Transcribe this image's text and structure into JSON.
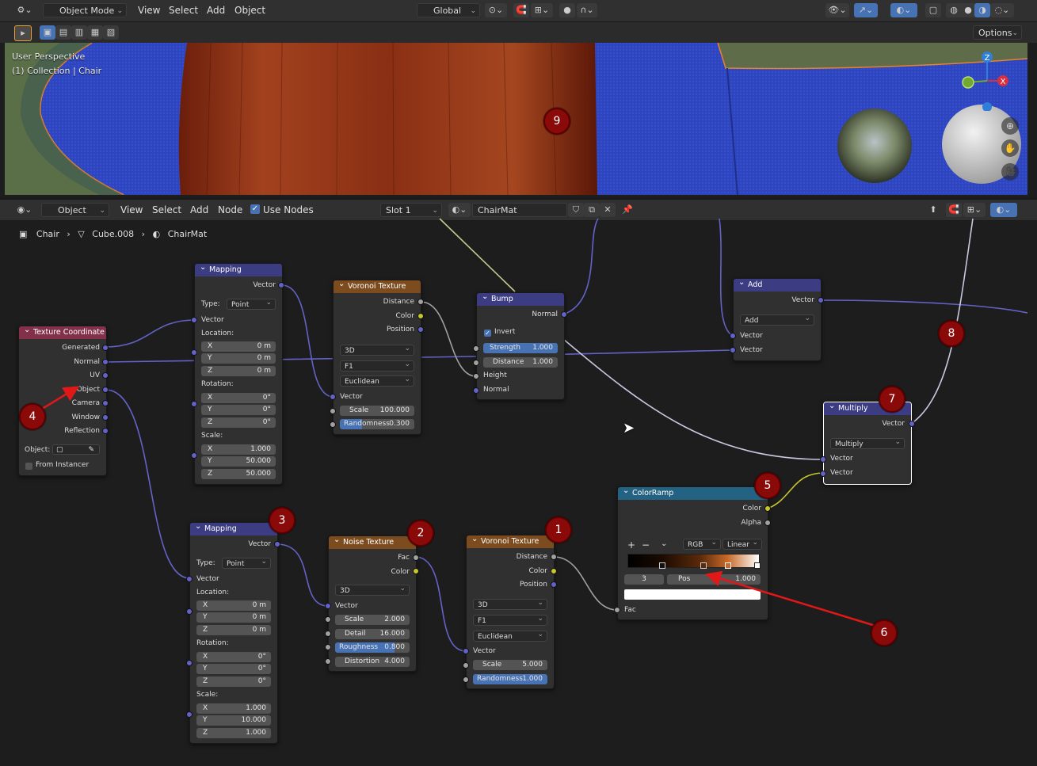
{
  "viewport_header": {
    "mode": "Object Mode",
    "menu": [
      "View",
      "Select",
      "Add",
      "Object"
    ],
    "orientation": "Global",
    "options": "Options"
  },
  "viewport": {
    "line1": "User Perspective",
    "line2": "(1) Collection | Chair",
    "gizmo": {
      "z": "Z",
      "x": "X"
    }
  },
  "node_header": {
    "object_mode": "Object",
    "menu": [
      "View",
      "Select",
      "Add",
      "Node"
    ],
    "use_nodes": "Use Nodes",
    "slot": "Slot 1",
    "material": "ChairMat"
  },
  "breadcrumb": {
    "a": "Chair",
    "b": "Cube.008",
    "c": "ChairMat"
  },
  "nodes": {
    "texcoord": {
      "title": "Texture Coordinate",
      "outputs": [
        "Generated",
        "Normal",
        "UV",
        "Object",
        "Camera",
        "Window",
        "Reflection"
      ],
      "object_label": "Object:",
      "from_instancer": "From Instancer"
    },
    "mapping1": {
      "title": "Mapping",
      "out": "Vector",
      "type_label": "Type:",
      "type": "Point",
      "vector": "Vector",
      "location": "Location:",
      "loc": [
        "0 m",
        "0 m",
        "0 m"
      ],
      "rotation": "Rotation:",
      "rot": [
        "0°",
        "0°",
        "0°"
      ],
      "scale": "Scale:",
      "scl": [
        "1.000",
        "50.000",
        "50.000"
      ]
    },
    "mapping2": {
      "title": "Mapping",
      "out": "Vector",
      "type_label": "Type:",
      "type": "Point",
      "vector": "Vector",
      "location": "Location:",
      "loc": [
        "0 m",
        "0 m",
        "0 m"
      ],
      "rotation": "Rotation:",
      "rot": [
        "0°",
        "0°",
        "0°"
      ],
      "scale": "Scale:",
      "scl": [
        "1.000",
        "10.000",
        "1.000"
      ]
    },
    "voronoi1": {
      "title": "Voronoi Texture",
      "outs": [
        "Distance",
        "Color",
        "Position"
      ],
      "dim": "3D",
      "feature": "F1",
      "metric": "Euclidean",
      "vector": "Vector",
      "scale_l": "Scale",
      "scale": "100.000",
      "rand_l": "Randomness",
      "rand": "0.300"
    },
    "bump": {
      "title": "Bump",
      "out": "Normal",
      "invert": "Invert",
      "strength_l": "Strength",
      "strength": "1.000",
      "distance_l": "Distance",
      "distance": "1.000",
      "height": "Height",
      "normal": "Normal"
    },
    "add": {
      "title": "Add",
      "out": "Vector",
      "op": "Add",
      "in1": "Vector",
      "in2": "Vector"
    },
    "multiply": {
      "title": "Multiply",
      "out": "Vector",
      "op": "Multiply",
      "in1": "Vector",
      "in2": "Vector"
    },
    "noise": {
      "title": "Noise Texture",
      "outs": [
        "Fac",
        "Color"
      ],
      "dim": "3D",
      "vector": "Vector",
      "scale_l": "Scale",
      "scale": "2.000",
      "detail_l": "Detail",
      "detail": "16.000",
      "rough_l": "Roughness",
      "rough": "0.800",
      "dist_l": "Distortion",
      "dist": "4.000"
    },
    "voronoi2": {
      "title": "Voronoi Texture",
      "outs": [
        "Distance",
        "Color",
        "Position"
      ],
      "dim": "3D",
      "feature": "F1",
      "metric": "Euclidean",
      "vector": "Vector",
      "scale_l": "Scale",
      "scale": "5.000",
      "rand_l": "Randomness",
      "rand": "1.000"
    },
    "colorramp": {
      "title": "ColorRamp",
      "outs": [
        "Color",
        "Alpha"
      ],
      "mode": "RGB",
      "interp": "Linear",
      "index": "3",
      "pos_l": "Pos",
      "pos": "1.000",
      "fac": "Fac"
    }
  },
  "badges": [
    "1",
    "2",
    "3",
    "4",
    "5",
    "6",
    "7",
    "8",
    "9"
  ],
  "colors": {
    "vector_socket": "#6363c7",
    "color_socket": "#c7c729",
    "float_socket": "#a1a1a1",
    "badge": "#8a0a0a",
    "annotation_arrow": "#e01818"
  }
}
